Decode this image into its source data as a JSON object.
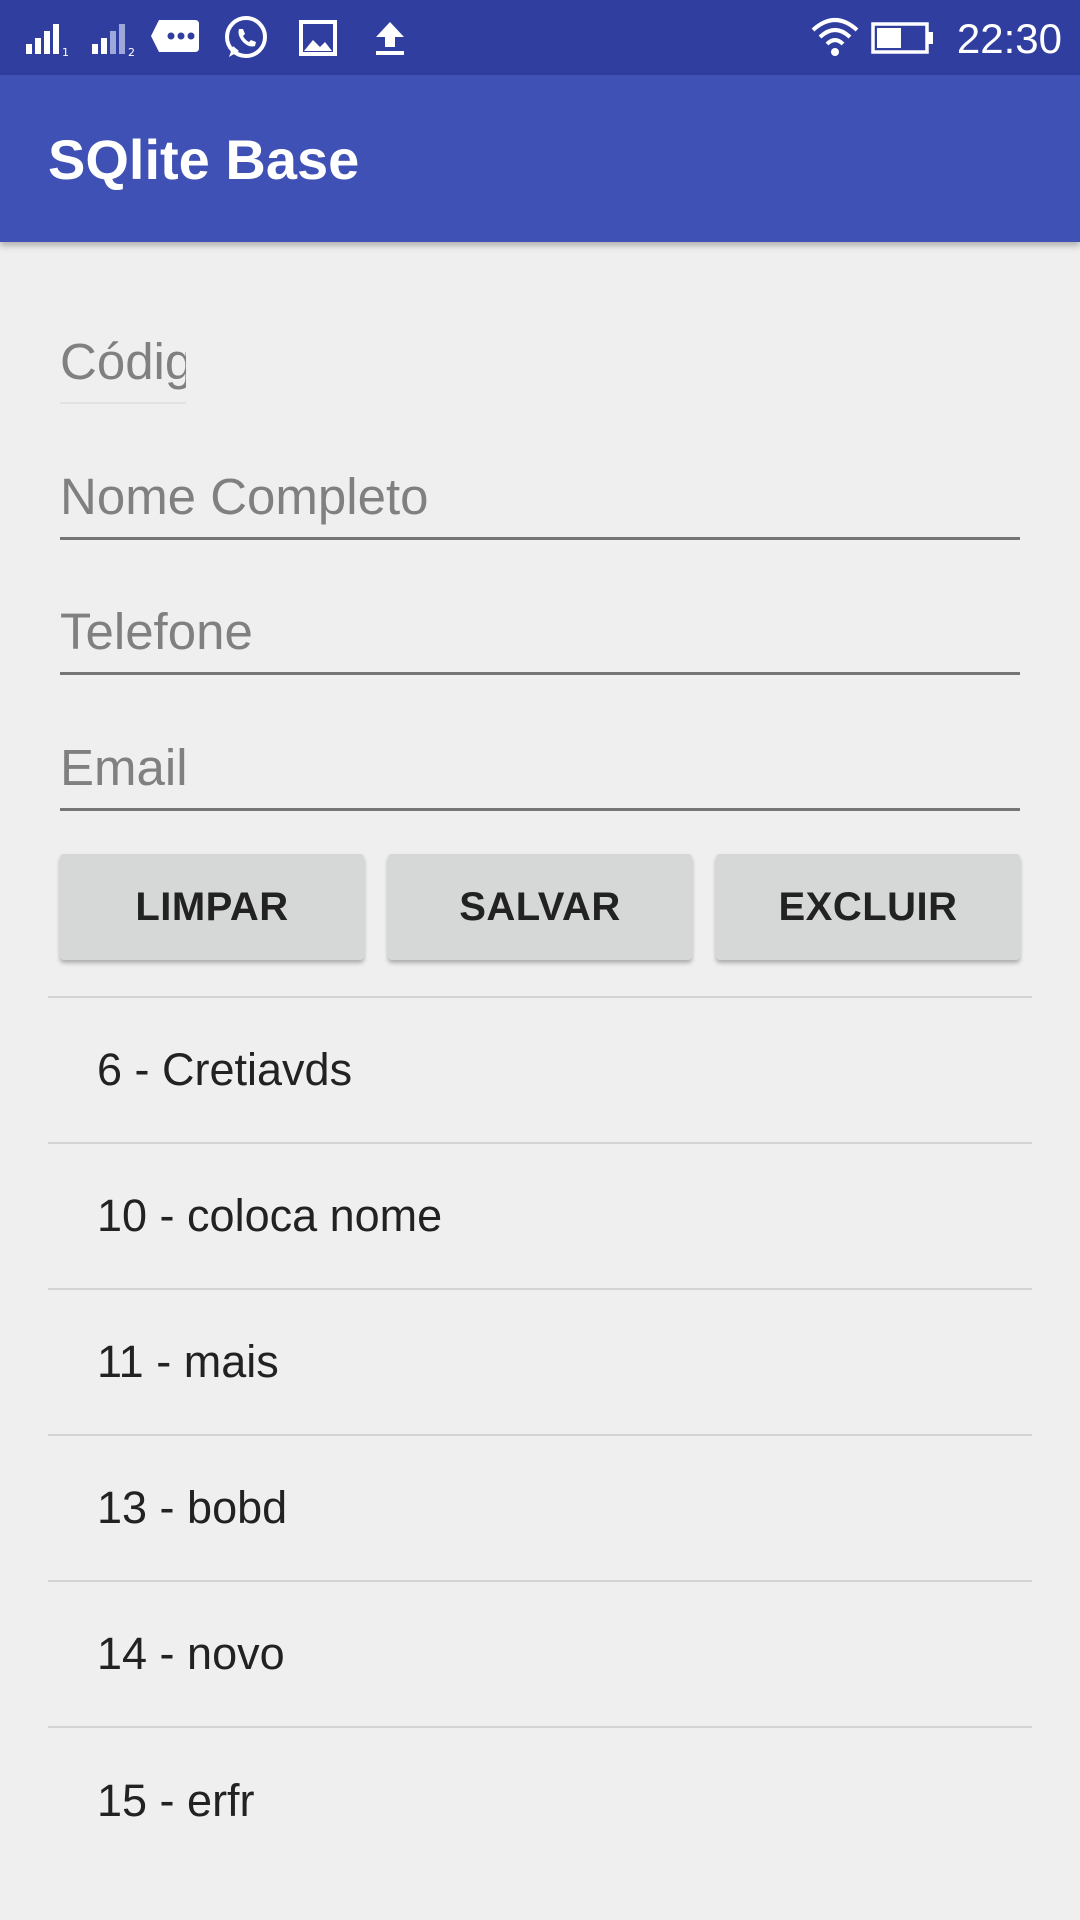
{
  "status_bar": {
    "time": "22:30",
    "icons": [
      "signal-sim1-icon",
      "signal-sim2-icon",
      "message-icon",
      "whatsapp-icon",
      "image-icon",
      "upload-icon",
      "wifi-icon",
      "battery-icon"
    ],
    "color": "#303f9f"
  },
  "app_bar": {
    "title": "SQlite Base",
    "color": "#3f51b5"
  },
  "form": {
    "codigo_placeholder": "Código",
    "codigo_value": "",
    "nome_placeholder": "Nome Completo",
    "nome_value": "",
    "telefone_placeholder": "Telefone",
    "telefone_value": "",
    "email_placeholder": "Email",
    "email_value": ""
  },
  "buttons": {
    "limpar": "LIMPAR",
    "salvar": "SALVAR",
    "excluir": "EXCLUIR"
  },
  "list": {
    "items": [
      "6 - Cretiavds",
      "10 - coloca nome",
      "11 - mais",
      "13 - bobd",
      "14 - novo",
      "15 - erfr"
    ]
  }
}
